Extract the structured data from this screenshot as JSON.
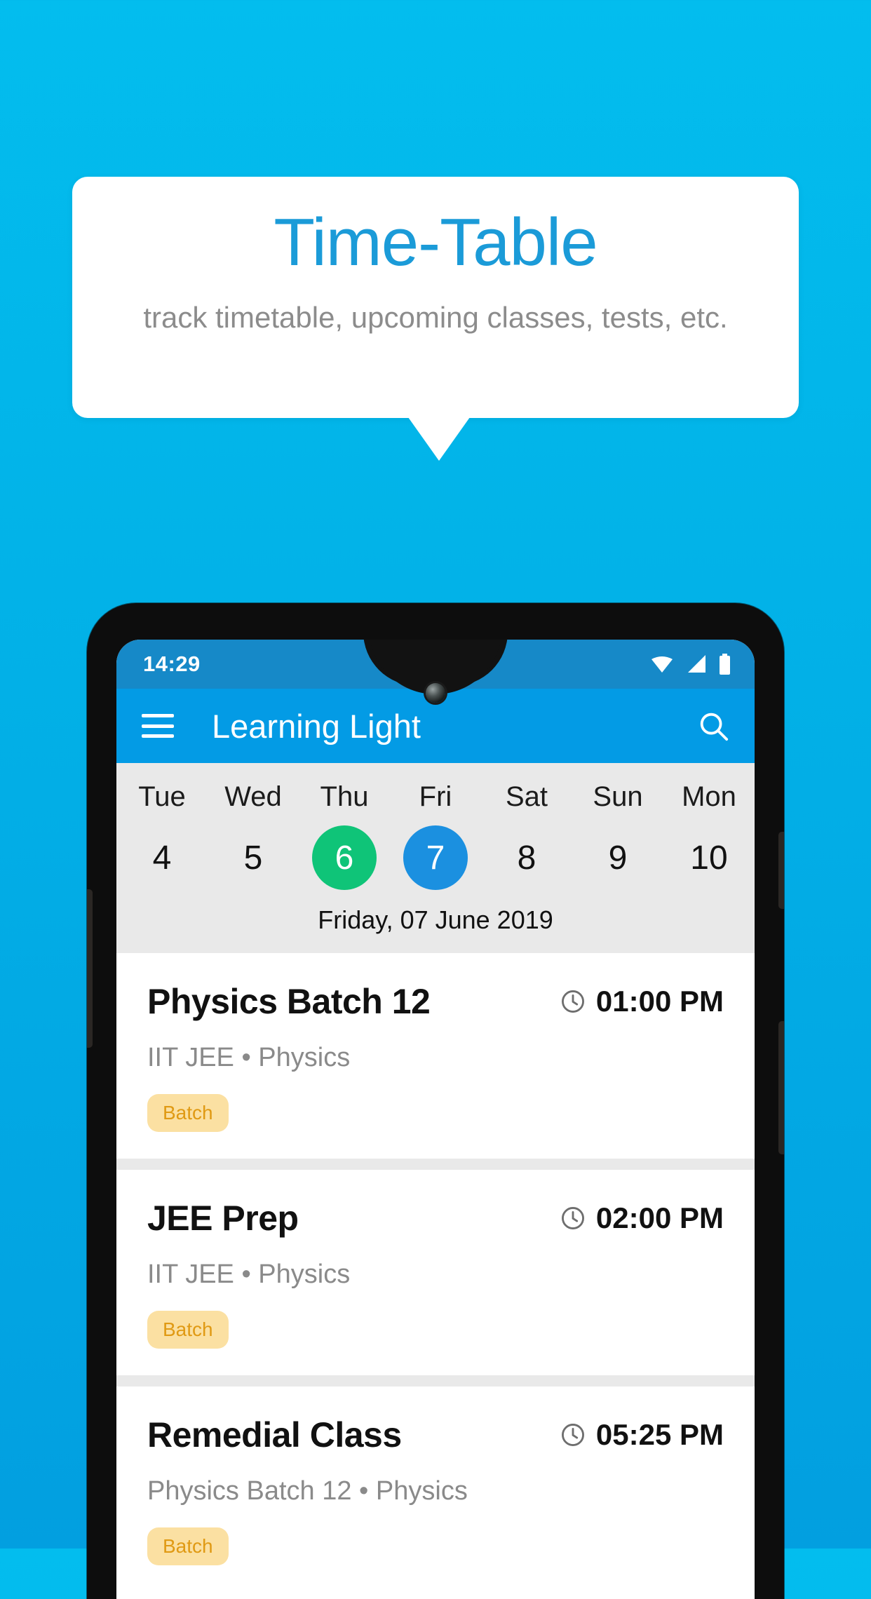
{
  "callout": {
    "title": "Time-Table",
    "subtitle": "track timetable, upcoming classes, tests, etc."
  },
  "colors": {
    "background_top": "#03BDEE",
    "background_bottom": "#029FE0",
    "callout_title": "#1B9BD8",
    "appbar": "#039BE5",
    "statusbar": "#1689C8",
    "today_green": "#0FC478",
    "selected_blue": "#1B90E0",
    "badge_bg": "#FBE0A2",
    "badge_text": "#E09A14",
    "strip_bg": "#E9E9E9"
  },
  "phone": {
    "statusbar": {
      "time": "14:29",
      "icons": [
        "wifi-icon",
        "signal-icon",
        "battery-icon"
      ]
    },
    "appbar": {
      "menu_icon": "hamburger-menu-icon",
      "title": "Learning Light",
      "search_icon": "search-icon"
    },
    "datestrip": {
      "days": [
        {
          "name": "Tue",
          "num": "4",
          "state": "normal"
        },
        {
          "name": "Wed",
          "num": "5",
          "state": "normal"
        },
        {
          "name": "Thu",
          "num": "6",
          "state": "today"
        },
        {
          "name": "Fri",
          "num": "7",
          "state": "selected"
        },
        {
          "name": "Sat",
          "num": "8",
          "state": "normal"
        },
        {
          "name": "Sun",
          "num": "9",
          "state": "normal"
        },
        {
          "name": "Mon",
          "num": "10",
          "state": "normal"
        }
      ],
      "full_date": "Friday, 07 June 2019"
    },
    "classes": [
      {
        "title": "Physics Batch 12",
        "time": "01:00 PM",
        "meta": "IIT JEE • Physics",
        "badge": "Batch"
      },
      {
        "title": "JEE Prep",
        "time": "02:00 PM",
        "meta": "IIT JEE • Physics",
        "badge": "Batch"
      },
      {
        "title": "Remedial Class",
        "time": "05:25 PM",
        "meta": "Physics Batch 12 • Physics",
        "badge": "Batch"
      }
    ]
  }
}
